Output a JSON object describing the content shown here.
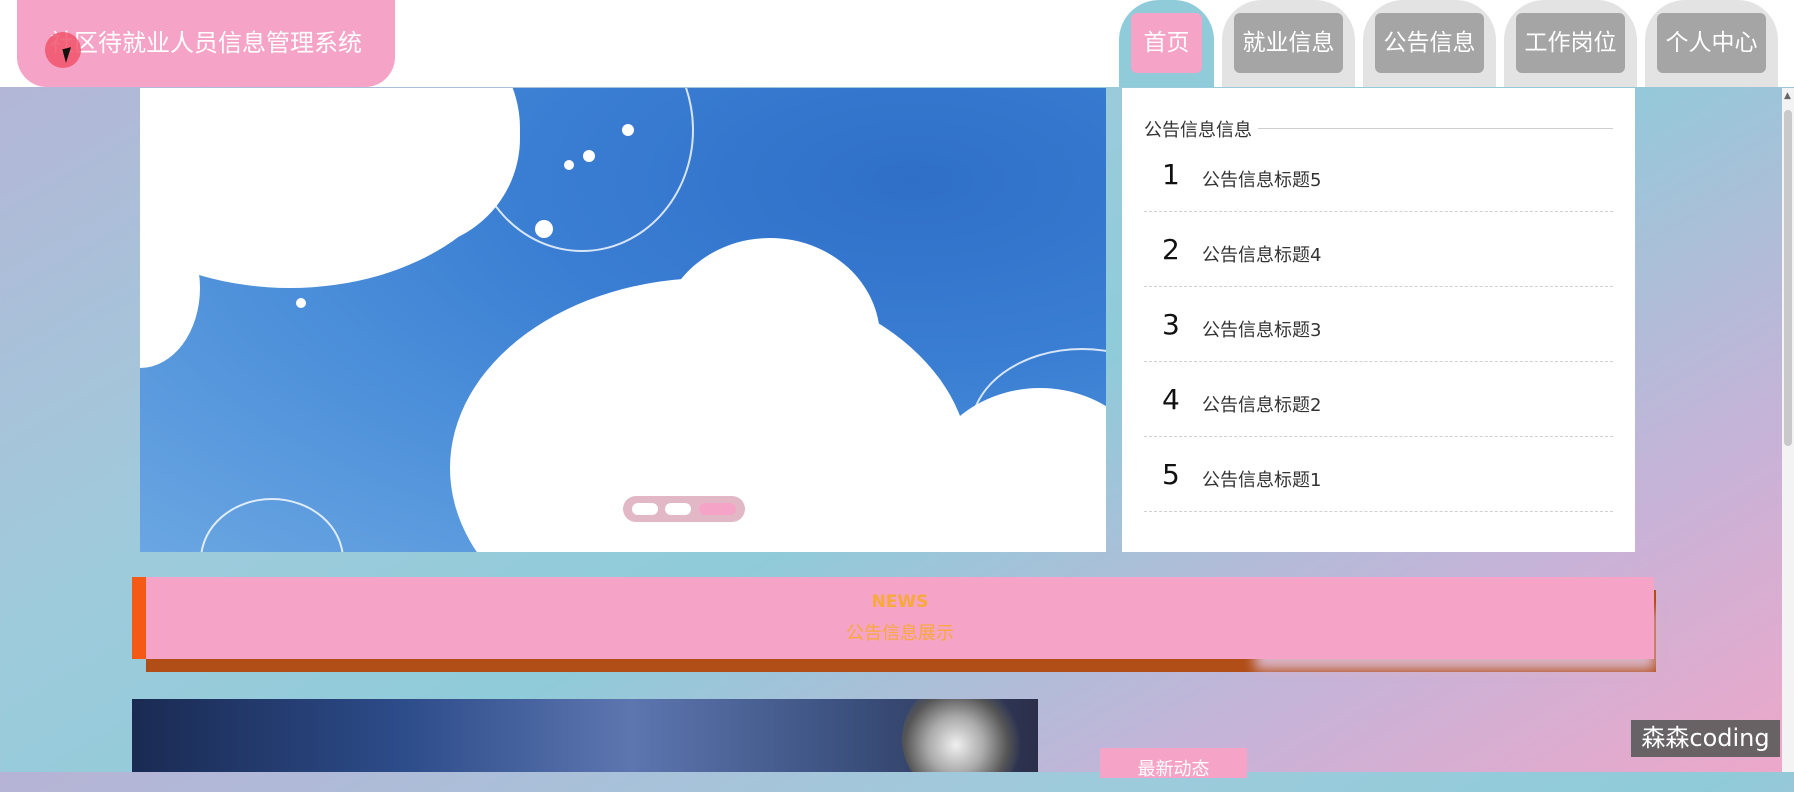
{
  "app": {
    "title": "社区待就业人员信息管理系统"
  },
  "nav": {
    "items": [
      {
        "label": "首页",
        "active": true
      },
      {
        "label": "就业信息"
      },
      {
        "label": "公告信息"
      },
      {
        "label": "工作岗位"
      },
      {
        "label": "个人中心"
      }
    ]
  },
  "notice": {
    "title": "公告信息信息",
    "items": [
      {
        "num": "1",
        "text": "公告信息标题5"
      },
      {
        "num": "2",
        "text": "公告信息标题4"
      },
      {
        "num": "3",
        "text": "公告信息标题3"
      },
      {
        "num": "4",
        "text": "公告信息标题2"
      },
      {
        "num": "5",
        "text": "公告信息标题1"
      }
    ]
  },
  "carousel": {
    "slide_count": 3,
    "active_slide": 3
  },
  "news": {
    "en": "NEWS",
    "cn": "公告信息展示"
  },
  "latest": {
    "label": "最新动态"
  },
  "watermark": "森森coding",
  "colors": {
    "brand_pink": "#f5a3c7",
    "nav_active_teal": "#8fcbd9",
    "nav_inactive": "#a5a5a5",
    "news_accent": "#f45a15",
    "news_text": "#f7a93a"
  }
}
